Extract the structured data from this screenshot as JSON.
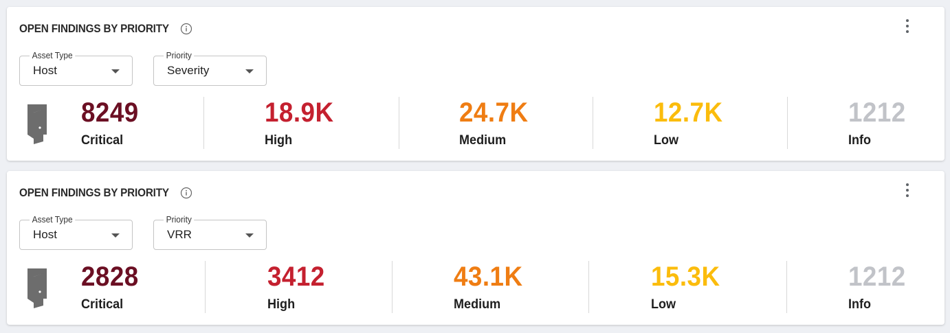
{
  "colors": {
    "critical": "#6b0f23",
    "high": "#c4202f",
    "medium": "#ef7d13",
    "low": "#fbbc0c",
    "info": "#c1c3c8"
  },
  "cards": [
    {
      "title": "OPEN FINDINGS BY PRIORITY",
      "info_icon": "info-circle-icon",
      "menu_icon": "more-vertical-icon",
      "asset_type": {
        "legend": "Asset Type",
        "value": "Host"
      },
      "priority": {
        "legend": "Priority",
        "value": "Severity"
      },
      "summary_icon": "door-icon",
      "stats": [
        {
          "key": "critical",
          "value": "8249",
          "label": "Critical"
        },
        {
          "key": "high",
          "value": "18.9K",
          "label": "High"
        },
        {
          "key": "medium",
          "value": "24.7K",
          "label": "Medium"
        },
        {
          "key": "low",
          "value": "12.7K",
          "label": "Low"
        },
        {
          "key": "info",
          "value": "1212",
          "label": "Info"
        }
      ]
    },
    {
      "title": "OPEN FINDINGS BY PRIORITY",
      "info_icon": "info-circle-icon",
      "menu_icon": "more-vertical-icon",
      "asset_type": {
        "legend": "Asset Type",
        "value": "Host"
      },
      "priority": {
        "legend": "Priority",
        "value": "VRR"
      },
      "summary_icon": "door-icon",
      "stats": [
        {
          "key": "critical",
          "value": "2828",
          "label": "Critical"
        },
        {
          "key": "high",
          "value": "3412",
          "label": "High"
        },
        {
          "key": "medium",
          "value": "43.1K",
          "label": "Medium"
        },
        {
          "key": "low",
          "value": "15.3K",
          "label": "Low"
        },
        {
          "key": "info",
          "value": "1212",
          "label": "Info"
        }
      ]
    }
  ]
}
